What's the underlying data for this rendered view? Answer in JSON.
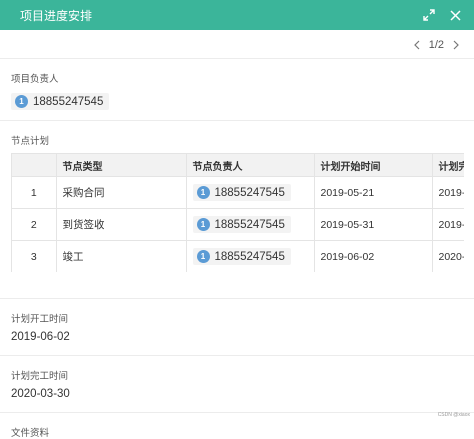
{
  "dialog": {
    "title": "项目进度安排"
  },
  "pager": {
    "text": "1/2"
  },
  "owner": {
    "label": "项目负责人",
    "avatar_text": "1",
    "phone": "18855247545"
  },
  "plan": {
    "label": "节点计划",
    "columns": [
      "",
      "节点类型",
      "节点负责人",
      "计划开始时间",
      "计划完成时间"
    ],
    "rows": [
      {
        "index": "1",
        "type": "采购合同",
        "owner_avatar": "1",
        "owner": "18855247545",
        "start": "2019-05-21",
        "end": "2019-0"
      },
      {
        "index": "2",
        "type": "到货签收",
        "owner_avatar": "1",
        "owner": "18855247545",
        "start": "2019-05-31",
        "end": "2019-0"
      },
      {
        "index": "3",
        "type": "竣工",
        "owner_avatar": "1",
        "owner": "18855247545",
        "start": "2019-06-02",
        "end": "2020-0"
      }
    ]
  },
  "fields": [
    {
      "label": "计划开工时间",
      "value": "2019-06-02"
    },
    {
      "label": "计划完工时间",
      "value": "2020-03-30"
    },
    {
      "label": "文件资料",
      "value": ""
    }
  ],
  "watermark": "CSDN @xiaox",
  "colors": {
    "titlebar": "#3bb59a",
    "avatar": "#5b9bd5"
  }
}
